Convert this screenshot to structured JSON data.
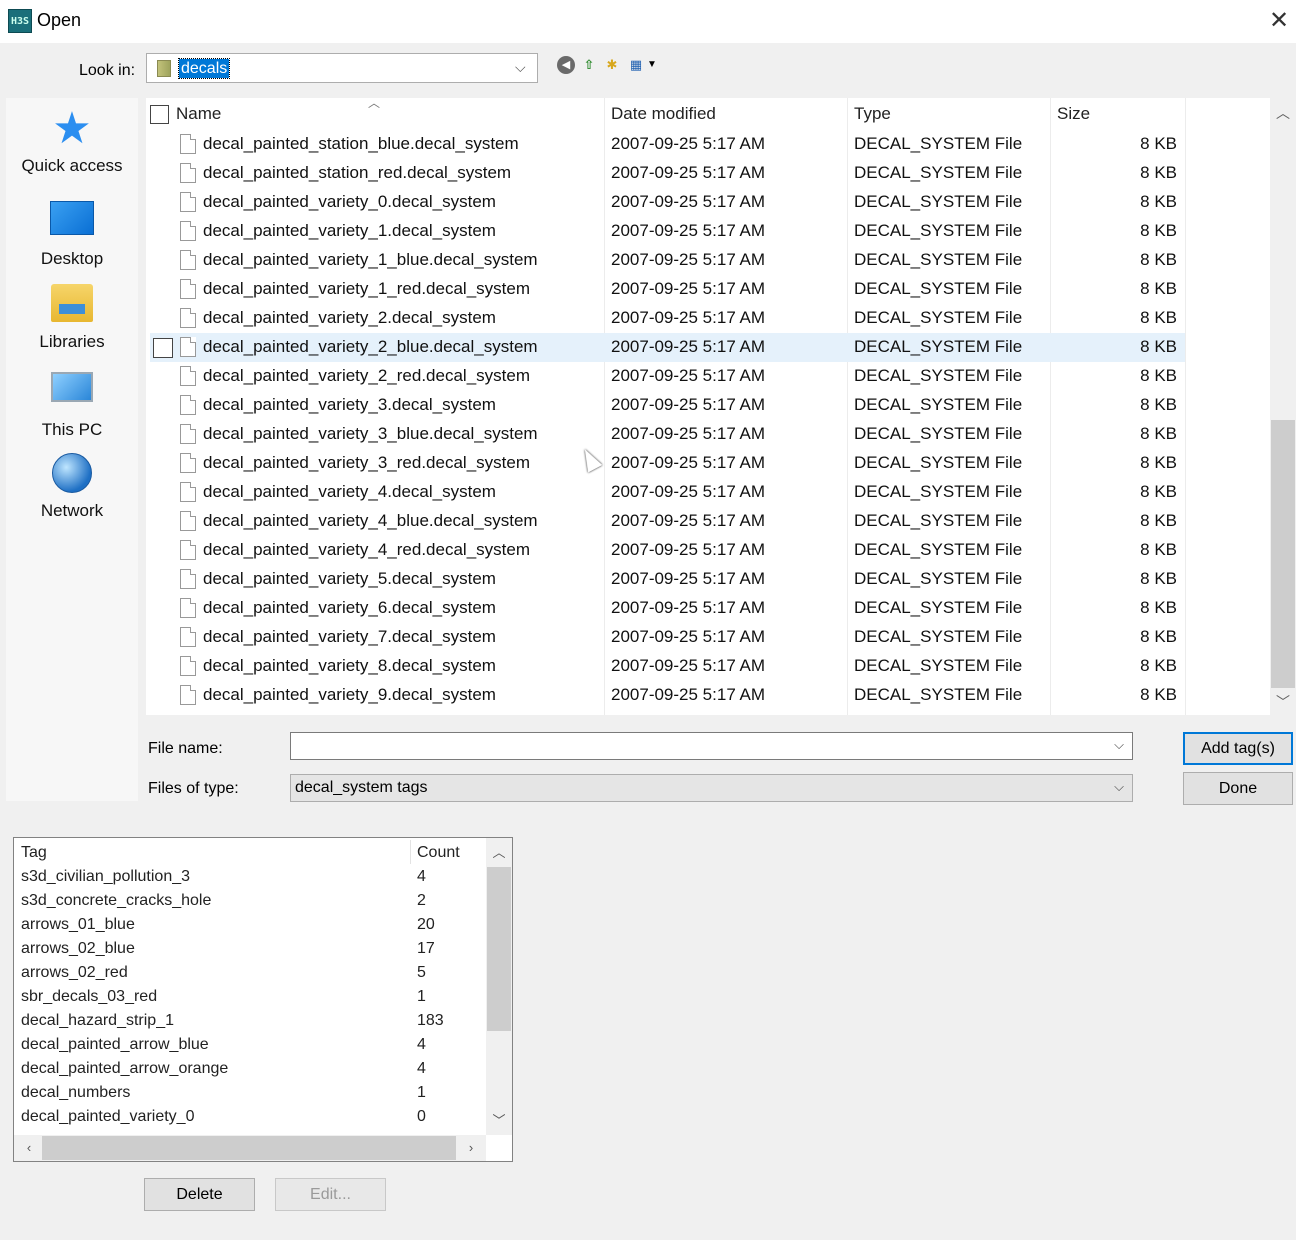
{
  "window": {
    "title": "Open",
    "app_icon_text": "H3S",
    "close_label": "✕"
  },
  "lookin": {
    "label": "Look in:",
    "value": "decals"
  },
  "places": [
    {
      "label": "Quick access",
      "icon": "quick-access-star-icon"
    },
    {
      "label": "Desktop",
      "icon": "desktop-icon"
    },
    {
      "label": "Libraries",
      "icon": "libraries-icon"
    },
    {
      "label": "This PC",
      "icon": "this-pc-icon"
    },
    {
      "label": "Network",
      "icon": "network-icon"
    }
  ],
  "columns": {
    "name": "Name",
    "date": "Date modified",
    "type": "Type",
    "size": "Size"
  },
  "files": [
    {
      "name": "decal_painted_station_blue.decal_system",
      "date": "2007-09-25 5:17 AM",
      "type": "DECAL_SYSTEM File",
      "size": "8 KB"
    },
    {
      "name": "decal_painted_station_red.decal_system",
      "date": "2007-09-25 5:17 AM",
      "type": "DECAL_SYSTEM File",
      "size": "8 KB"
    },
    {
      "name": "decal_painted_variety_0.decal_system",
      "date": "2007-09-25 5:17 AM",
      "type": "DECAL_SYSTEM File",
      "size": "8 KB"
    },
    {
      "name": "decal_painted_variety_1.decal_system",
      "date": "2007-09-25 5:17 AM",
      "type": "DECAL_SYSTEM File",
      "size": "8 KB"
    },
    {
      "name": "decal_painted_variety_1_blue.decal_system",
      "date": "2007-09-25 5:17 AM",
      "type": "DECAL_SYSTEM File",
      "size": "8 KB"
    },
    {
      "name": "decal_painted_variety_1_red.decal_system",
      "date": "2007-09-25 5:17 AM",
      "type": "DECAL_SYSTEM File",
      "size": "8 KB"
    },
    {
      "name": "decal_painted_variety_2.decal_system",
      "date": "2007-09-25 5:17 AM",
      "type": "DECAL_SYSTEM File",
      "size": "8 KB"
    },
    {
      "name": "decal_painted_variety_2_blue.decal_system",
      "date": "2007-09-25 5:17 AM",
      "type": "DECAL_SYSTEM File",
      "size": "8 KB"
    },
    {
      "name": "decal_painted_variety_2_red.decal_system",
      "date": "2007-09-25 5:17 AM",
      "type": "DECAL_SYSTEM File",
      "size": "8 KB"
    },
    {
      "name": "decal_painted_variety_3.decal_system",
      "date": "2007-09-25 5:17 AM",
      "type": "DECAL_SYSTEM File",
      "size": "8 KB"
    },
    {
      "name": "decal_painted_variety_3_blue.decal_system",
      "date": "2007-09-25 5:17 AM",
      "type": "DECAL_SYSTEM File",
      "size": "8 KB"
    },
    {
      "name": "decal_painted_variety_3_red.decal_system",
      "date": "2007-09-25 5:17 AM",
      "type": "DECAL_SYSTEM File",
      "size": "8 KB"
    },
    {
      "name": "decal_painted_variety_4.decal_system",
      "date": "2007-09-25 5:17 AM",
      "type": "DECAL_SYSTEM File",
      "size": "8 KB"
    },
    {
      "name": "decal_painted_variety_4_blue.decal_system",
      "date": "2007-09-25 5:17 AM",
      "type": "DECAL_SYSTEM File",
      "size": "8 KB"
    },
    {
      "name": "decal_painted_variety_4_red.decal_system",
      "date": "2007-09-25 5:17 AM",
      "type": "DECAL_SYSTEM File",
      "size": "8 KB"
    },
    {
      "name": "decal_painted_variety_5.decal_system",
      "date": "2007-09-25 5:17 AM",
      "type": "DECAL_SYSTEM File",
      "size": "8 KB"
    },
    {
      "name": "decal_painted_variety_6.decal_system",
      "date": "2007-09-25 5:17 AM",
      "type": "DECAL_SYSTEM File",
      "size": "8 KB"
    },
    {
      "name": "decal_painted_variety_7.decal_system",
      "date": "2007-09-25 5:17 AM",
      "type": "DECAL_SYSTEM File",
      "size": "8 KB"
    },
    {
      "name": "decal_painted_variety_8.decal_system",
      "date": "2007-09-25 5:17 AM",
      "type": "DECAL_SYSTEM File",
      "size": "8 KB"
    },
    {
      "name": "decal_painted_variety_9.decal_system",
      "date": "2007-09-25 5:17 AM",
      "type": "DECAL_SYSTEM File",
      "size": "8 KB"
    }
  ],
  "hovered_file_index": 7,
  "filename": {
    "label": "File name:",
    "value": ""
  },
  "filetype": {
    "label": "Files of type:",
    "value": "decal_system tags"
  },
  "buttons": {
    "add": "Add tag(s)",
    "done": "Done",
    "delete": "Delete",
    "edit": "Edit..."
  },
  "tags": {
    "columns": {
      "tag": "Tag",
      "count": "Count"
    },
    "rows": [
      {
        "tag": "s3d_civilian_pollution_3",
        "count": "4"
      },
      {
        "tag": "s3d_concrete_cracks_hole",
        "count": "2"
      },
      {
        "tag": "arrows_01_blue",
        "count": "20"
      },
      {
        "tag": "arrows_02_blue",
        "count": "17"
      },
      {
        "tag": "arrows_02_red",
        "count": "5"
      },
      {
        "tag": "sbr_decals_03_red",
        "count": "1"
      },
      {
        "tag": "decal_hazard_strip_1",
        "count": "183"
      },
      {
        "tag": "decal_painted_arrow_blue",
        "count": "4"
      },
      {
        "tag": "decal_painted_arrow_orange",
        "count": "4"
      },
      {
        "tag": "decal_numbers",
        "count": "1"
      },
      {
        "tag": "decal_painted_variety_0",
        "count": "0"
      }
    ]
  },
  "colors": {
    "accent": "#0078d7",
    "hover_row": "#e5f1fb"
  }
}
